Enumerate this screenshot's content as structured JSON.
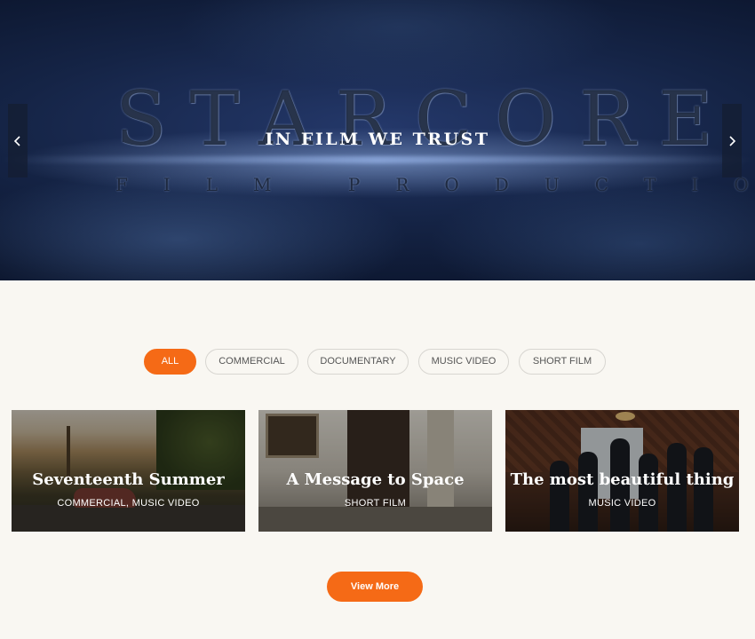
{
  "hero": {
    "logo_text": "STARCORE STUDIO",
    "logo_subtext": "FILM PRODUCTION",
    "tagline": "IN FILM WE TRUST",
    "prev_icon": "chevron-left-icon",
    "next_icon": "chevron-right-icon"
  },
  "filters": {
    "items": [
      {
        "label": "ALL",
        "active": true
      },
      {
        "label": "COMMERCIAL",
        "active": false
      },
      {
        "label": "DOCUMENTARY",
        "active": false
      },
      {
        "label": "MUSIC VIDEO",
        "active": false
      },
      {
        "label": "SHORT FILM",
        "active": false
      }
    ]
  },
  "projects": [
    {
      "title": "Seventeenth Summer",
      "tags": "COMMERCIAL, MUSIC VIDEO"
    },
    {
      "title": "A Message to Space",
      "tags": "SHORT FILM"
    },
    {
      "title": "The most beautiful thing",
      "tags": "MUSIC VIDEO"
    }
  ],
  "view_more_label": "View More",
  "colors": {
    "accent": "#f56a16",
    "background": "#f9f7f2",
    "pill_border": "#d8d6d1"
  }
}
